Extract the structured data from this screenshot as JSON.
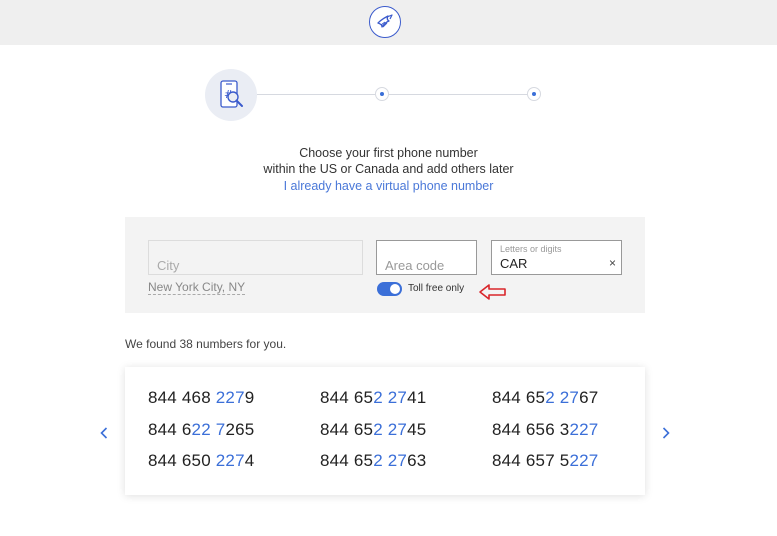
{
  "header": {
    "logo_icon": "bird-logo-icon"
  },
  "stepper": {
    "step1_icon": "phone-search-icon",
    "steps": 3,
    "current": 1
  },
  "intro": {
    "line1": "Choose your first phone number",
    "line2": "within the US or Canada and add others later",
    "link": "I already have a virtual phone number"
  },
  "search": {
    "city_placeholder": "City",
    "city_hint": "New York City, NY",
    "area_placeholder": "Area code",
    "letters_label": "Letters or digits",
    "letters_value": "CAR",
    "clear_icon": "×",
    "toll_free_label": "Toll free only",
    "toll_free_on": true
  },
  "results": {
    "summary": "We found 38 numbers for you.",
    "numbers": [
      {
        "plain": "844 468 ",
        "highlight": "227",
        "rest": "9"
      },
      {
        "plain": "844 65",
        "highlight": "2 27",
        "rest": "41"
      },
      {
        "plain": "844 65",
        "highlight": "2 27",
        "rest": "67"
      },
      {
        "plain": "844 6",
        "highlight": "22 7",
        "rest": "265"
      },
      {
        "plain": "844 65",
        "highlight": "2 27",
        "rest": "45"
      },
      {
        "plain": "844 656 3",
        "highlight": "227",
        "rest": ""
      },
      {
        "plain": "844 650 ",
        "highlight": "227",
        "rest": "4"
      },
      {
        "plain": "844 65",
        "highlight": "2 27",
        "rest": "63"
      },
      {
        "plain": "844 657 5",
        "highlight": "227",
        "rest": ""
      }
    ],
    "prev_icon": "chevron-left-icon",
    "next_icon": "chevron-right-icon"
  },
  "colors": {
    "accent": "#3b6fd8",
    "annotation": "#d9262b",
    "header_bg": "#efefef",
    "panel_bg": "#f3f3f3"
  }
}
